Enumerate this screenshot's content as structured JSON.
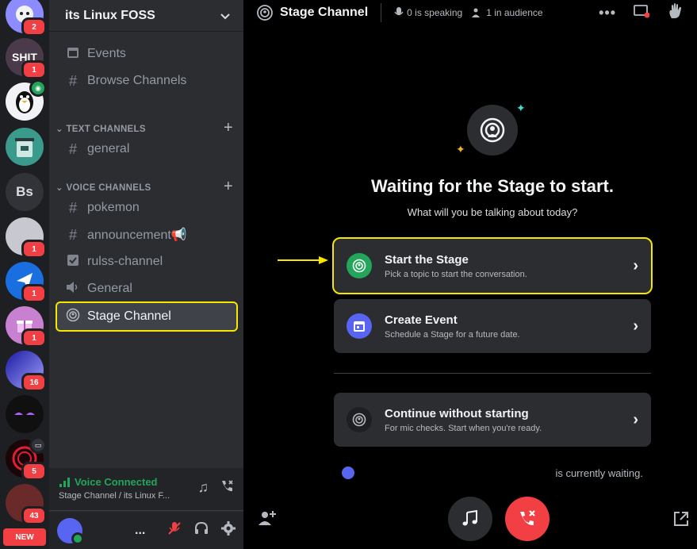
{
  "servers": [
    {
      "name": "server-1",
      "badge": "2",
      "color": "#8c8cff",
      "label": ""
    },
    {
      "name": "server-2",
      "badge": "1",
      "color": "#5a4a5a",
      "label": "SHIT"
    },
    {
      "name": "server-3",
      "badge": "",
      "color": "#f2f3f5",
      "label": ""
    },
    {
      "name": "server-4",
      "badge": "",
      "color": "#3a9a8c",
      "label": ""
    },
    {
      "name": "server-bs",
      "badge": "",
      "color": "#313338",
      "label": "Bs"
    },
    {
      "name": "server-6",
      "badge": "1",
      "color": "#c8c8d0",
      "label": ""
    },
    {
      "name": "server-7",
      "badge": "1",
      "color": "#1a6fe0",
      "label": ""
    },
    {
      "name": "server-8",
      "badge": "1",
      "color": "#c880d0",
      "label": ""
    },
    {
      "name": "server-9",
      "badge": "16",
      "color": "#3a3acc",
      "label": ""
    },
    {
      "name": "server-10",
      "badge": "",
      "color": "#101010",
      "label": ""
    },
    {
      "name": "server-11",
      "badge": "5",
      "color": "#2a0a10",
      "label": ""
    },
    {
      "name": "server-12",
      "badge": "43",
      "color": "#6a2a2a",
      "label": ""
    }
  ],
  "rail": {
    "new_label": "NEW"
  },
  "guild": {
    "name": "its Linux FOSS"
  },
  "nav": {
    "events": "Events",
    "browse": "Browse Channels"
  },
  "categories": {
    "text": "TEXT CHANNELS",
    "voice": "VOICE CHANNELS"
  },
  "channels": {
    "general_text": "general",
    "pokemon": "pokemon",
    "announcement": "announcement📢",
    "rulss": "rulss-channel",
    "general_voice": "General",
    "stage": "Stage Channel"
  },
  "voice_panel": {
    "status": "Voice Connected",
    "sub": "Stage Channel / its Linux F..."
  },
  "user_panel": {
    "dots": "..."
  },
  "topbar": {
    "title": "Stage Channel",
    "speaking": "0 is speaking",
    "audience": "1 in audience"
  },
  "stage": {
    "title": "Waiting for the Stage to start.",
    "subtitle": "What will you be talking about today?",
    "options": [
      {
        "title": "Start the Stage",
        "desc": "Pick a topic to start the conversation.",
        "color": "#23a55a"
      },
      {
        "title": "Create Event",
        "desc": "Schedule a Stage for a future date.",
        "color": "#5865f2"
      },
      {
        "title": "Continue without starting",
        "desc": "For mic checks. Start when you're ready.",
        "color": "#313338"
      }
    ],
    "waiting": "is currently waiting."
  },
  "colors": {
    "accent_green": "#23a55a",
    "danger": "#f23f43",
    "highlight": "#f7e600",
    "blurple": "#5865f2"
  }
}
